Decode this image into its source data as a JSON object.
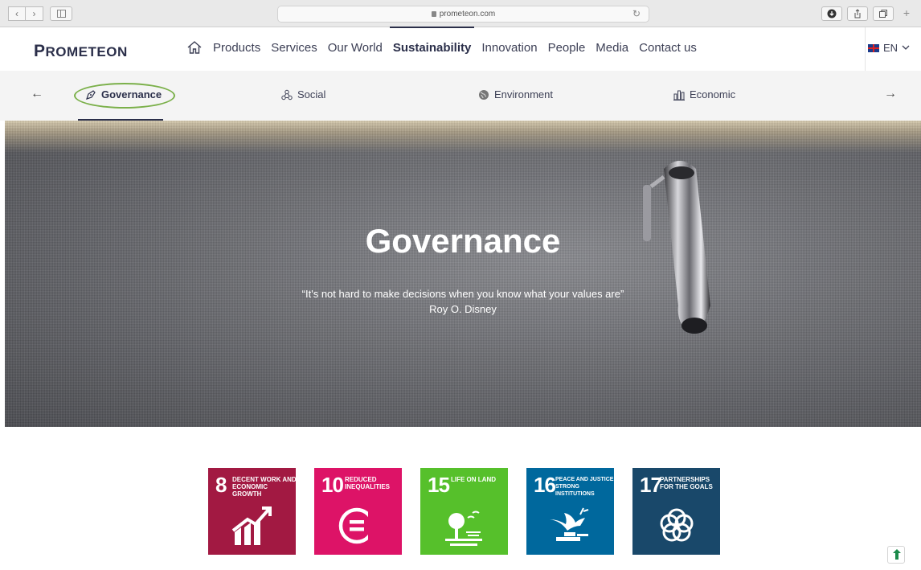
{
  "browser": {
    "url": "prometeon.com",
    "back_glyph": "‹",
    "forward_glyph": "›",
    "reload_glyph": "↻",
    "plus_glyph": "+"
  },
  "header": {
    "logo": "PROMETEON",
    "nav": [
      "Products",
      "Services",
      "Our World",
      "Sustainability",
      "Innovation",
      "People",
      "Media",
      "Contact us"
    ],
    "active_nav": "Sustainability",
    "language": "EN"
  },
  "subnav": {
    "prev_arrow": "←",
    "next_arrow": "→",
    "items": [
      {
        "label": "Governance",
        "icon": "pen-icon",
        "active": true
      },
      {
        "label": "Social",
        "icon": "people-network-icon"
      },
      {
        "label": "Environment",
        "icon": "globe-icon"
      },
      {
        "label": "Economic",
        "icon": "building-chart-icon"
      }
    ],
    "highlight_color": "#7bb04a"
  },
  "hero": {
    "title": "Governance",
    "quote": "“It's not hard to make decisions when you know what your values are”",
    "author": "Roy O. Disney"
  },
  "sdgs": [
    {
      "number": "8",
      "label": "Decent work and economic growth",
      "color": "#a21942",
      "icon": "growth-chart-icon"
    },
    {
      "number": "10",
      "label": "Reduced inequalities",
      "color": "#dd1367",
      "icon": "equality-icon"
    },
    {
      "number": "15",
      "label": "Life on land",
      "color": "#56c02b",
      "icon": "tree-icon"
    },
    {
      "number": "16",
      "label": "Peace and justice strong institutions",
      "color": "#00689d",
      "icon": "dove-gavel-icon"
    },
    {
      "number": "17",
      "label": "Partnerships for the goals",
      "color": "#19486a",
      "icon": "flower-rings-icon"
    }
  ]
}
